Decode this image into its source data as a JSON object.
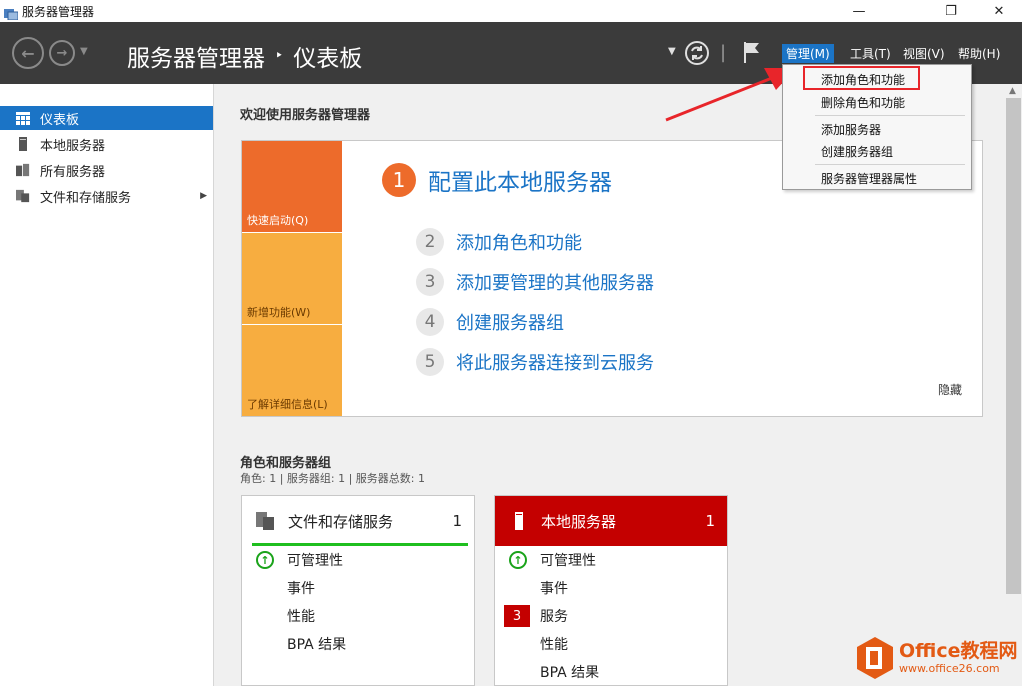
{
  "window": {
    "title": "服务器管理器",
    "controls": {
      "minimize": "—",
      "restore": "❐",
      "close": "✕"
    }
  },
  "header": {
    "breadcrumb_root": "服务器管理器",
    "breadcrumb_sep": "‣",
    "breadcrumb_current": "仪表板",
    "menus": [
      "管理(M)",
      "工具(T)",
      "视图(V)",
      "帮助(H)"
    ],
    "active_menu_index": 0
  },
  "sidebar": {
    "items": [
      {
        "label": "仪表板",
        "icon": "dashboard-icon",
        "active": true
      },
      {
        "label": "本地服务器",
        "icon": "server-icon",
        "active": false
      },
      {
        "label": "所有服务器",
        "icon": "servers-icon",
        "active": false
      },
      {
        "label": "文件和存储服务",
        "icon": "file-storage-icon",
        "active": false,
        "expandable": true
      }
    ]
  },
  "welcome": {
    "title": "欢迎使用服务器管理器",
    "tiles": [
      "快速启动(Q)",
      "新增功能(W)",
      "了解详细信息(L)"
    ],
    "primary_step": {
      "num": "1",
      "label": "配置此本地服务器"
    },
    "steps": [
      {
        "num": "2",
        "label": "添加角色和功能"
      },
      {
        "num": "3",
        "label": "添加要管理的其他服务器"
      },
      {
        "num": "4",
        "label": "创建服务器组"
      },
      {
        "num": "5",
        "label": "将此服务器连接到云服务"
      }
    ],
    "hide": "隐藏"
  },
  "roles": {
    "title": "角色和服务器组",
    "summary": "角色: 1 | 服务器组: 1 | 服务器总数: 1",
    "cards": [
      {
        "title": "文件和存储服务",
        "count": "1",
        "rows": [
          "可管理性",
          "事件",
          "性能",
          "BPA 结果"
        ]
      },
      {
        "title": "本地服务器",
        "count": "1",
        "rows": [
          "可管理性",
          "事件",
          "服务",
          "性能",
          "BPA 结果"
        ],
        "service_badge": "3"
      }
    ]
  },
  "dropdown": {
    "items": [
      "添加角色和功能",
      "删除角色和功能",
      "添加服务器",
      "创建服务器组",
      "服务器管理器属性"
    ]
  },
  "watermark": {
    "name": "Office教程网",
    "url": "www.office26.com"
  },
  "colors": {
    "accent": "#1b74c6",
    "header_bg": "#3b3b3b",
    "orange": "#ed6b2b",
    "amber": "#f7ad40",
    "red": "#c40000",
    "green": "#1aa31a",
    "highlight_red": "#e8252a"
  }
}
